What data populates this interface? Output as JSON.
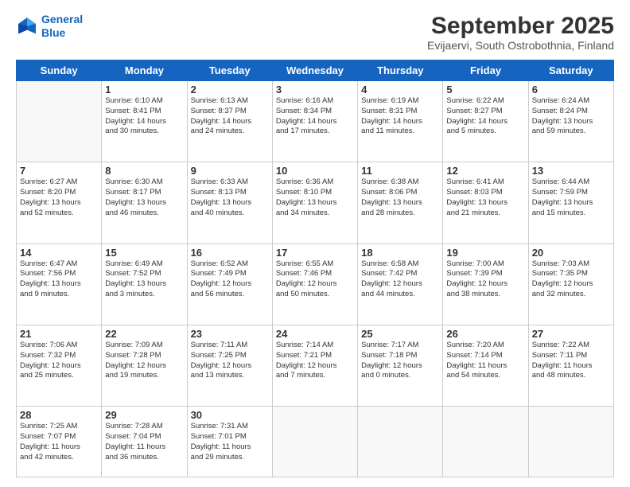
{
  "logo": {
    "line1": "General",
    "line2": "Blue"
  },
  "header": {
    "month": "September 2025",
    "location": "Evijaervi, South Ostrobothnia, Finland"
  },
  "weekdays": [
    "Sunday",
    "Monday",
    "Tuesday",
    "Wednesday",
    "Thursday",
    "Friday",
    "Saturday"
  ],
  "weeks": [
    [
      {
        "day": "",
        "info": ""
      },
      {
        "day": "1",
        "info": "Sunrise: 6:10 AM\nSunset: 8:41 PM\nDaylight: 14 hours\nand 30 minutes."
      },
      {
        "day": "2",
        "info": "Sunrise: 6:13 AM\nSunset: 8:37 PM\nDaylight: 14 hours\nand 24 minutes."
      },
      {
        "day": "3",
        "info": "Sunrise: 6:16 AM\nSunset: 8:34 PM\nDaylight: 14 hours\nand 17 minutes."
      },
      {
        "day": "4",
        "info": "Sunrise: 6:19 AM\nSunset: 8:31 PM\nDaylight: 14 hours\nand 11 minutes."
      },
      {
        "day": "5",
        "info": "Sunrise: 6:22 AM\nSunset: 8:27 PM\nDaylight: 14 hours\nand 5 minutes."
      },
      {
        "day": "6",
        "info": "Sunrise: 6:24 AM\nSunset: 8:24 PM\nDaylight: 13 hours\nand 59 minutes."
      }
    ],
    [
      {
        "day": "7",
        "info": "Sunrise: 6:27 AM\nSunset: 8:20 PM\nDaylight: 13 hours\nand 52 minutes."
      },
      {
        "day": "8",
        "info": "Sunrise: 6:30 AM\nSunset: 8:17 PM\nDaylight: 13 hours\nand 46 minutes."
      },
      {
        "day": "9",
        "info": "Sunrise: 6:33 AM\nSunset: 8:13 PM\nDaylight: 13 hours\nand 40 minutes."
      },
      {
        "day": "10",
        "info": "Sunrise: 6:36 AM\nSunset: 8:10 PM\nDaylight: 13 hours\nand 34 minutes."
      },
      {
        "day": "11",
        "info": "Sunrise: 6:38 AM\nSunset: 8:06 PM\nDaylight: 13 hours\nand 28 minutes."
      },
      {
        "day": "12",
        "info": "Sunrise: 6:41 AM\nSunset: 8:03 PM\nDaylight: 13 hours\nand 21 minutes."
      },
      {
        "day": "13",
        "info": "Sunrise: 6:44 AM\nSunset: 7:59 PM\nDaylight: 13 hours\nand 15 minutes."
      }
    ],
    [
      {
        "day": "14",
        "info": "Sunrise: 6:47 AM\nSunset: 7:56 PM\nDaylight: 13 hours\nand 9 minutes."
      },
      {
        "day": "15",
        "info": "Sunrise: 6:49 AM\nSunset: 7:52 PM\nDaylight: 13 hours\nand 3 minutes."
      },
      {
        "day": "16",
        "info": "Sunrise: 6:52 AM\nSunset: 7:49 PM\nDaylight: 12 hours\nand 56 minutes."
      },
      {
        "day": "17",
        "info": "Sunrise: 6:55 AM\nSunset: 7:46 PM\nDaylight: 12 hours\nand 50 minutes."
      },
      {
        "day": "18",
        "info": "Sunrise: 6:58 AM\nSunset: 7:42 PM\nDaylight: 12 hours\nand 44 minutes."
      },
      {
        "day": "19",
        "info": "Sunrise: 7:00 AM\nSunset: 7:39 PM\nDaylight: 12 hours\nand 38 minutes."
      },
      {
        "day": "20",
        "info": "Sunrise: 7:03 AM\nSunset: 7:35 PM\nDaylight: 12 hours\nand 32 minutes."
      }
    ],
    [
      {
        "day": "21",
        "info": "Sunrise: 7:06 AM\nSunset: 7:32 PM\nDaylight: 12 hours\nand 25 minutes."
      },
      {
        "day": "22",
        "info": "Sunrise: 7:09 AM\nSunset: 7:28 PM\nDaylight: 12 hours\nand 19 minutes."
      },
      {
        "day": "23",
        "info": "Sunrise: 7:11 AM\nSunset: 7:25 PM\nDaylight: 12 hours\nand 13 minutes."
      },
      {
        "day": "24",
        "info": "Sunrise: 7:14 AM\nSunset: 7:21 PM\nDaylight: 12 hours\nand 7 minutes."
      },
      {
        "day": "25",
        "info": "Sunrise: 7:17 AM\nSunset: 7:18 PM\nDaylight: 12 hours\nand 0 minutes."
      },
      {
        "day": "26",
        "info": "Sunrise: 7:20 AM\nSunset: 7:14 PM\nDaylight: 11 hours\nand 54 minutes."
      },
      {
        "day": "27",
        "info": "Sunrise: 7:22 AM\nSunset: 7:11 PM\nDaylight: 11 hours\nand 48 minutes."
      }
    ],
    [
      {
        "day": "28",
        "info": "Sunrise: 7:25 AM\nSunset: 7:07 PM\nDaylight: 11 hours\nand 42 minutes."
      },
      {
        "day": "29",
        "info": "Sunrise: 7:28 AM\nSunset: 7:04 PM\nDaylight: 11 hours\nand 36 minutes."
      },
      {
        "day": "30",
        "info": "Sunrise: 7:31 AM\nSunset: 7:01 PM\nDaylight: 11 hours\nand 29 minutes."
      },
      {
        "day": "",
        "info": ""
      },
      {
        "day": "",
        "info": ""
      },
      {
        "day": "",
        "info": ""
      },
      {
        "day": "",
        "info": ""
      }
    ]
  ]
}
